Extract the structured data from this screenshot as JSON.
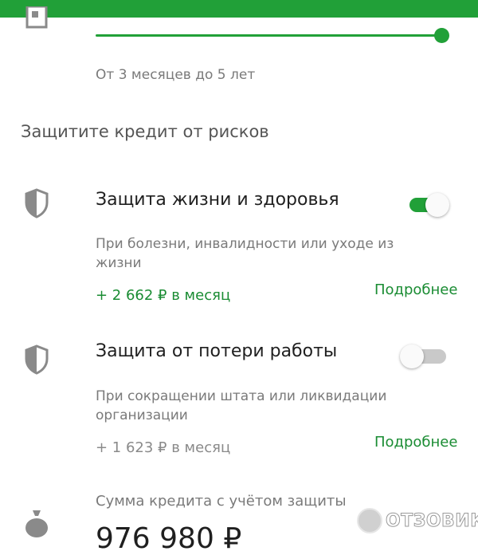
{
  "colors": {
    "brand": "#21a038",
    "link": "#1a8c33",
    "muted": "#7a7a7a"
  },
  "term": {
    "icon": "calendar-icon",
    "slider_fraction": 1.0,
    "hint": "От 3 месяцев до 5 лет"
  },
  "protection": {
    "section_title": "Защитите кредит от рисков",
    "options": [
      {
        "icon": "shield-icon",
        "title": "Защита жизни и здоровья",
        "description": "При болезни, инвалидности или уходе из жизни",
        "price": "+ 2 662 ₽ в месяц",
        "more": "Подробнее",
        "enabled": true
      },
      {
        "icon": "shield-icon",
        "title": "Защита от потери работы",
        "description": "При сокращении штата или ликвидации организации",
        "price": "+ 1 623 ₽ в месяц",
        "more": "Подробнее",
        "enabled": false
      }
    ]
  },
  "summary": {
    "icon": "money-bag-icon",
    "label": "Сумма кредита с учётом защиты",
    "value": "976 980 ₽"
  },
  "watermark": {
    "text": "ОТЗОВИК"
  }
}
